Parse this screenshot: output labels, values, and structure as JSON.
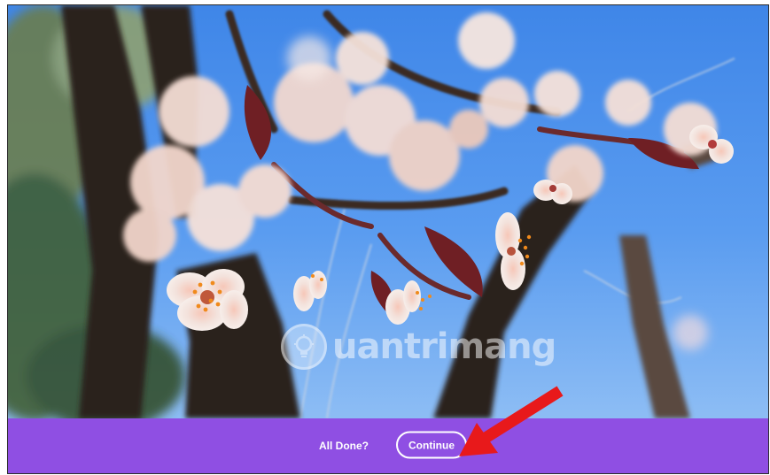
{
  "footer": {
    "prompt_label": "All Done?",
    "continue_label": "Continue",
    "background_color": "#8f4fe3"
  },
  "watermark": {
    "text": "uantrimang",
    "icon": "lightbulb-icon"
  },
  "annotation": {
    "icon": "red-arrow-icon",
    "color": "#e8191b"
  },
  "photo": {
    "subject": "cherry-blossom-branches"
  }
}
